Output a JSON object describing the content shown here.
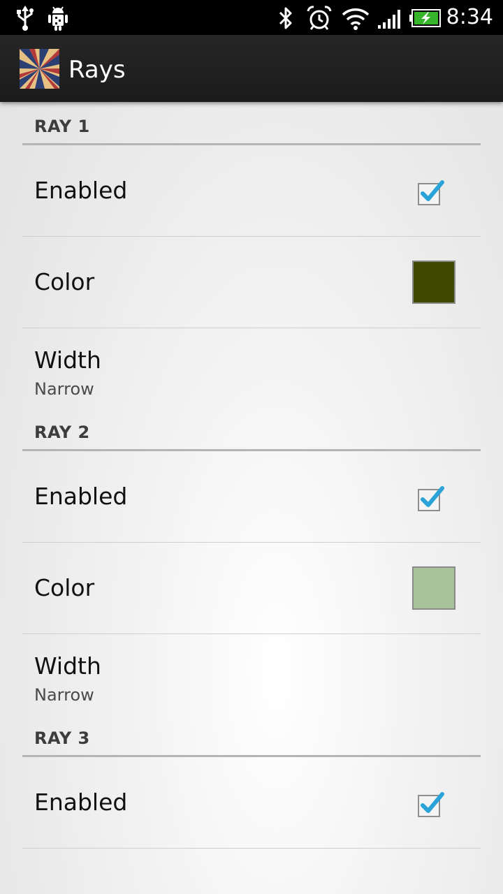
{
  "status_bar": {
    "time": "8:34",
    "icons": [
      "usb-icon",
      "android-debug-icon",
      "bluetooth-icon",
      "alarm-icon",
      "wifi-icon",
      "signal-icon",
      "battery-charging-icon"
    ]
  },
  "action_bar": {
    "title": "Rays",
    "icon": "rays-app-icon"
  },
  "colors": {
    "checkbox_accent": "#2aa3d8",
    "ray1_color": "#3f4a00",
    "ray2_color": "#a8c29a"
  },
  "sections": [
    {
      "header": "RAY 1",
      "enabled_label": "Enabled",
      "enabled_checked": true,
      "color_label": "Color",
      "width_label": "Width",
      "width_value": "Narrow"
    },
    {
      "header": "RAY 2",
      "enabled_label": "Enabled",
      "enabled_checked": true,
      "color_label": "Color",
      "width_label": "Width",
      "width_value": "Narrow"
    },
    {
      "header": "RAY 3",
      "enabled_label": "Enabled",
      "enabled_checked": true
    }
  ]
}
